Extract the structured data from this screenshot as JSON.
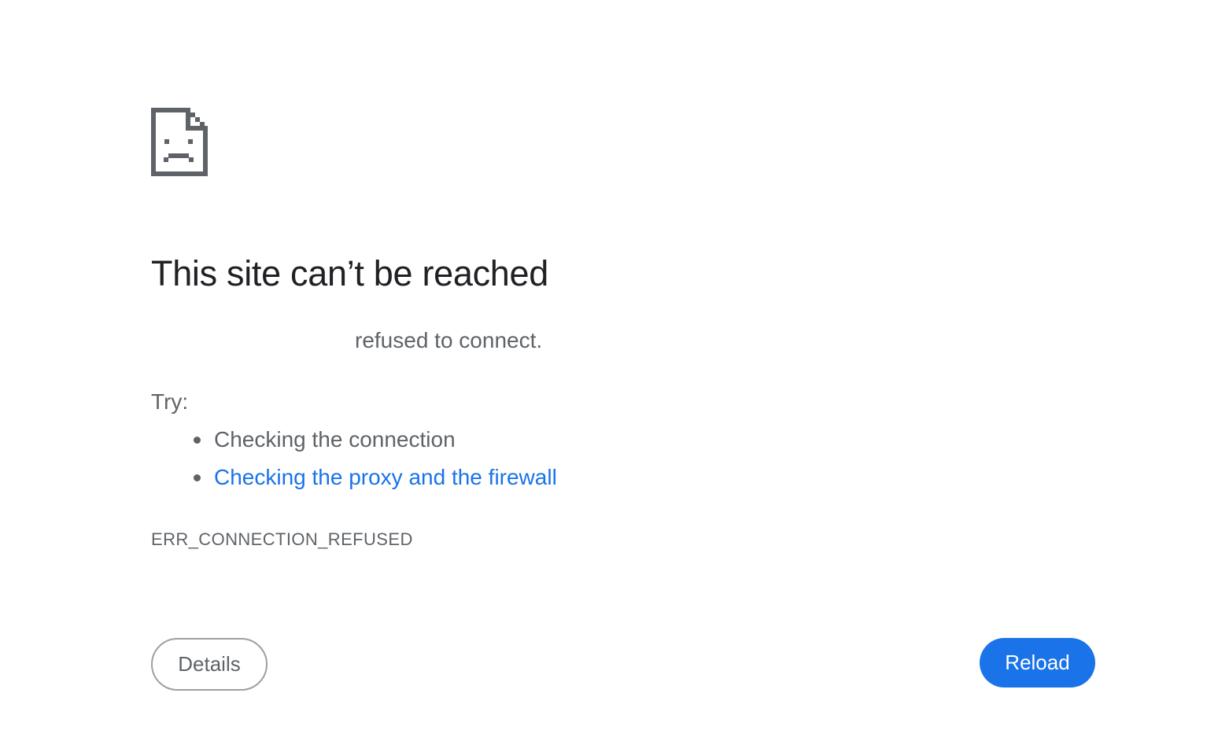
{
  "error": {
    "icon": "sad-page-icon",
    "title": "This site can’t be reached",
    "summary": "refused to connect.",
    "try_label": "Try:",
    "suggestions": [
      {
        "text": "Checking the connection",
        "is_link": false
      },
      {
        "text": "Checking the proxy and the firewall",
        "is_link": true
      }
    ],
    "code": "ERR_CONNECTION_REFUSED"
  },
  "buttons": {
    "details_label": "Details",
    "reload_label": "Reload"
  },
  "colors": {
    "title": "#202124",
    "body_text": "#5f6368",
    "link": "#1a73e8",
    "icon": "#5f6368",
    "reload_bg": "#1a73e8",
    "details_border": "#9aa0a6"
  }
}
